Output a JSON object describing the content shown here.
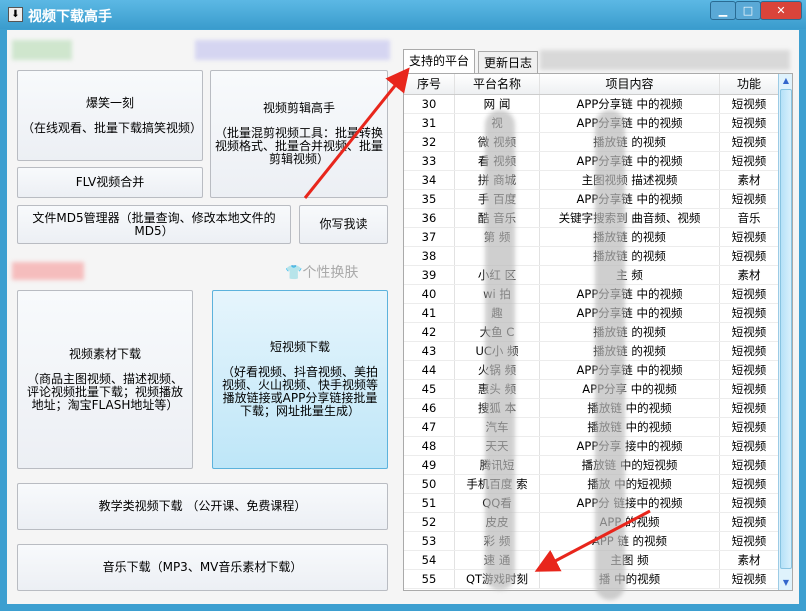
{
  "window": {
    "title": "视频下载高手",
    "min": "▁",
    "max": "□",
    "close": "✕"
  },
  "left": {
    "b1": {
      "title": "爆笑一刻",
      "desc": "（在线观看、批量下载搞笑视频）"
    },
    "b2": {
      "title": "视频剪辑高手",
      "desc": "（批量混剪视频工具：批量转换视频格式、批量合并视频、批量剪辑视频）"
    },
    "b3": "FLV视频合并",
    "b4": "文件MD5管理器（批量查询、修改本地文件的MD5）",
    "b5": "你写我读",
    "skin": "个性换肤",
    "b6": {
      "title": "视频素材下载",
      "desc": "（商品主图视频、描述视频、评论视频批量下载；视频播放地址；淘宝FLASH地址等）"
    },
    "b7": {
      "title": "短视频下载",
      "desc": "（好看视频、抖音视频、美拍视频、火山视频、快手视频等播放链接或APP分享链接批量下载；网址批量生成）"
    },
    "b8": "教学类视频下载 （公开课、免费课程）",
    "b9": "音乐下载（MP3、MV音乐素材下载）"
  },
  "tabs": [
    "支持的平台",
    "更新日志"
  ],
  "table": {
    "headers": [
      "序号",
      "平台名称",
      "项目内容",
      "功能"
    ],
    "rows": [
      [
        "30",
        "网 闻",
        "APP分享链 中的视频",
        "短视频"
      ],
      [
        "31",
        "  视",
        "APP分享链 中的视频",
        "短视频"
      ],
      [
        "32",
        "微 视频",
        "播放链 的视频",
        "短视频"
      ],
      [
        "33",
        "看 视频",
        "APP分享链 中的视频",
        "短视频"
      ],
      [
        "34",
        "拼 商城",
        "主图视频 描述视频",
        "素材"
      ],
      [
        "35",
        "手 百度",
        "APP分享链 中的视频",
        "短视频"
      ],
      [
        "36",
        "酷 音乐",
        "关键字搜索到 曲音频、视频",
        "音乐"
      ],
      [
        "37",
        "第 频",
        "播放链 的视频",
        "短视频"
      ],
      [
        "38",
        "",
        "播放链 的视频",
        "短视频"
      ],
      [
        "39",
        "小红 区",
        "主 频",
        "素材"
      ],
      [
        "40",
        "wi 拍",
        "APP分享链 中的视频",
        "短视频"
      ],
      [
        "41",
        "趣 ",
        "APP分享链 中的视频",
        "短视频"
      ],
      [
        "42",
        "大鱼 C",
        "播放链 的视频",
        "短视频"
      ],
      [
        "43",
        "UC小 频",
        "播放链 的视频",
        "短视频"
      ],
      [
        "44",
        "火锅 频",
        "APP分享链 中的视频",
        "短视频"
      ],
      [
        "45",
        "惠头 频",
        "APP分享 中的视频",
        "短视频"
      ],
      [
        "46",
        "搜狐 本",
        "播放链 中的视频",
        "短视频"
      ],
      [
        "47",
        "汽车 ",
        "播放链 中的视频",
        "短视频"
      ],
      [
        "48",
        "天天 ",
        "APP分享 接中的视频",
        "短视频"
      ],
      [
        "49",
        "腾讯短 ",
        "播放链 中的短视频",
        "短视频"
      ],
      [
        "50",
        "手机百度 索",
        "播放 中的短视频",
        "短视频"
      ],
      [
        "51",
        "QQ看 ",
        "APP分 链接中的视频",
        "短视频"
      ],
      [
        "52",
        "皮皮 ",
        "APP 的视频",
        "短视频"
      ],
      [
        "53",
        "彩 频",
        "APP 链 的视频",
        "短视频"
      ],
      [
        "54",
        "速 通",
        "主图 频",
        "素材"
      ],
      [
        "55",
        "QT游戏时刻",
        "播 中的视频",
        "短视频"
      ]
    ]
  },
  "colors": {
    "title": "#3a9ccd",
    "accent": "#5cb2dc",
    "arrow": "#e8261c"
  }
}
